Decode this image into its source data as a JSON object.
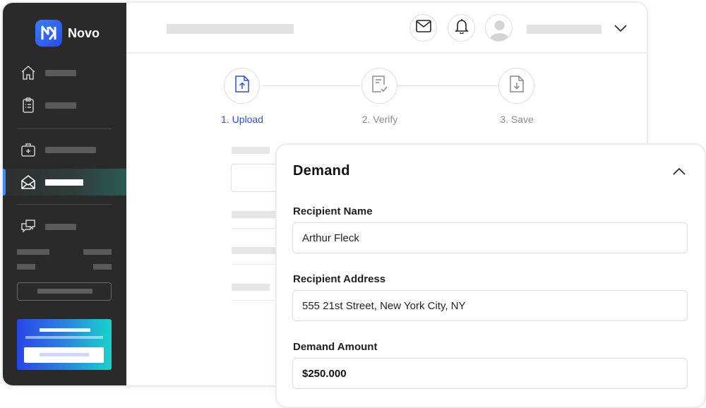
{
  "brand": {
    "name": "Novo",
    "accent": "#2f4fd8"
  },
  "sidebar": {
    "items": [
      {
        "icon": "home-icon"
      },
      {
        "icon": "clipboard-icon"
      },
      {
        "icon": "medical-kit-icon"
      },
      {
        "icon": "envelope-open-icon",
        "active": true
      },
      {
        "icon": "chat-bubbles-icon"
      }
    ]
  },
  "topbar": {
    "icons": [
      "mail-icon",
      "bell-icon",
      "avatar-icon",
      "chevron-down-icon"
    ]
  },
  "stepper": {
    "steps": [
      {
        "label": "1. Upload",
        "icon": "upload-file-icon",
        "active": true
      },
      {
        "label": "2. Verify",
        "icon": "verify-document-icon",
        "active": false
      },
      {
        "label": "3. Save",
        "icon": "download-file-icon",
        "active": false
      }
    ]
  },
  "demand": {
    "title": "Demand",
    "fields": [
      {
        "label": "Recipient Name",
        "value": "Arthur Fleck"
      },
      {
        "label": "Recipient Address",
        "value": "555 21st Street, New York City, NY"
      },
      {
        "label": "Demand Amount",
        "value": "$250.000"
      }
    ]
  }
}
